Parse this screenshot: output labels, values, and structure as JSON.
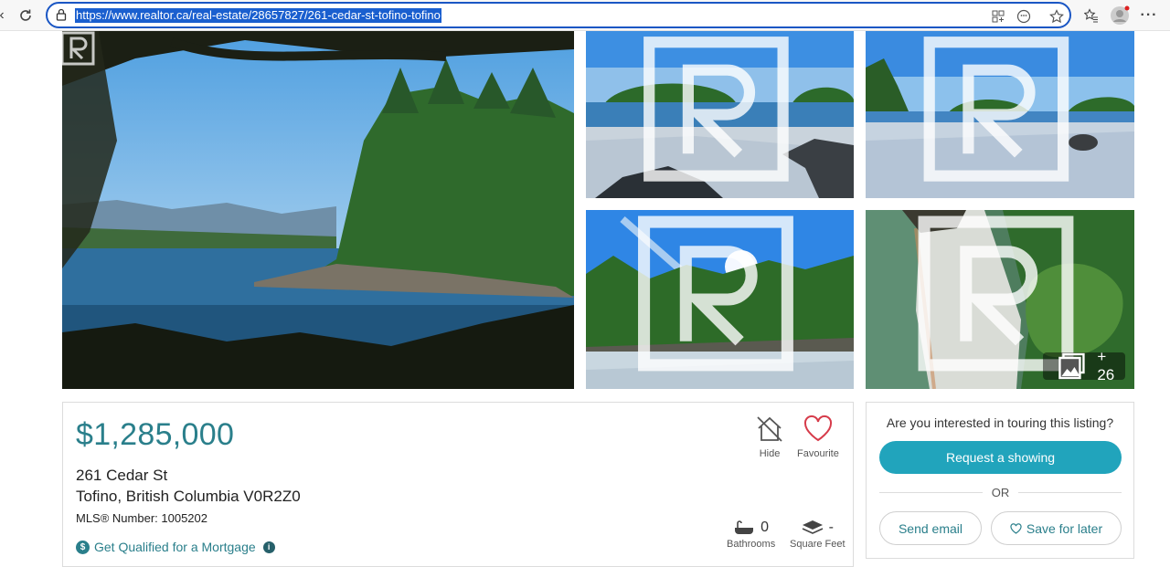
{
  "browser": {
    "url": "https://www.realtor.ca/real-estate/28657827/261-cedar-st-tofino-tofino"
  },
  "gallery": {
    "more_count": "+ 26"
  },
  "listing": {
    "price": "$1,285,000",
    "address_line1": "261 Cedar St",
    "address_line2": "Tofino, British Columbia V0R2Z0",
    "mls_label": "MLS® Number: 1005202",
    "mortgage_link": "Get Qualified for a Mortgage",
    "hide_label": "Hide",
    "favourite_label": "Favourite",
    "bathrooms_value": "0",
    "bathrooms_label": "Bathrooms",
    "sqft_value": "-",
    "sqft_label": "Square Feet"
  },
  "contact": {
    "question": "Are you interested in touring this listing?",
    "request_label": "Request a showing",
    "or_label": "OR",
    "email_label": "Send email",
    "save_label": "Save for later"
  },
  "colors": {
    "accent": "#2a7f8b",
    "button": "#21a4bc",
    "favourite": "#d63b4a",
    "url_highlight": "#1a5fcf"
  }
}
